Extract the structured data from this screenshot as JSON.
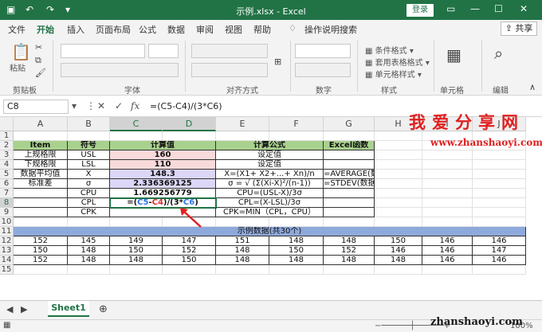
{
  "window": {
    "title": "示例.xlsx - Excel",
    "login": "登录"
  },
  "tabs": [
    "文件",
    "开始",
    "插入",
    "页面布局",
    "公式",
    "数据",
    "审阅",
    "视图",
    "帮助"
  ],
  "tell_me": "操作说明搜索",
  "share": "共享",
  "ribbon": {
    "paste": "粘贴",
    "clipboard": "剪贴板",
    "font": "字体",
    "alignment": "对齐方式",
    "number": "数字",
    "styles": "样式",
    "cells": "单元格",
    "editing": "编辑",
    "cond_format": "条件格式",
    "table_format": "套用表格格式",
    "cell_styles": "单元格样式"
  },
  "formula_bar": {
    "name_box": "C8",
    "fx": "fx",
    "formula": "=(C5-C4)/(3*C6)"
  },
  "columns": [
    "A",
    "B",
    "C",
    "D",
    "E",
    "F",
    "G",
    "H",
    "I",
    "J"
  ],
  "rows": [
    "1",
    "2",
    "3",
    "4",
    "5",
    "6",
    "7",
    "8",
    "9",
    "10",
    "11",
    "12",
    "13",
    "14",
    "15"
  ],
  "table": {
    "headers": [
      "Item",
      "符号",
      "计算值",
      "计算公式",
      "Excel函数"
    ],
    "rows": [
      {
        "item": "上规格限",
        "sym": "USL",
        "val": "160",
        "formula": "设定值",
        "excel": ""
      },
      {
        "item": "下规格限",
        "sym": "LSL",
        "val": "110",
        "formula": "设定值",
        "excel": ""
      },
      {
        "item": "数据平均值",
        "sym": "X",
        "val": "148.3",
        "formula": "X=(X1+ X2+...+ Xn)/n",
        "excel": "=AVERAGE(数据区域)"
      },
      {
        "item": "标准差",
        "sym": "σ",
        "val": "2.336369125",
        "formula": "σ = √ (Σ(Xi-X)²/(n-1))",
        "excel": "=STDEV(数据区域)"
      },
      {
        "item": "",
        "sym": "CPU",
        "val": "1.669256779",
        "formula": "CPU=(USL-X)/3σ",
        "excel": ""
      },
      {
        "item": "",
        "sym": "CPL",
        "val": "",
        "formula": "CPL=(X-LSL)/3σ",
        "excel": ""
      },
      {
        "item": "",
        "sym": "CPK",
        "val": "",
        "formula": "CPK=MIN（CPL，CPU）",
        "excel": ""
      }
    ],
    "cpl_formula_parts": [
      "=(",
      "C5",
      "-",
      "C4",
      ")/(3*",
      "C6",
      ")"
    ]
  },
  "sample": {
    "title": "示例数据(共30个)",
    "rows": [
      [
        "152",
        "145",
        "149",
        "147",
        "151",
        "148",
        "148",
        "150",
        "146",
        "146"
      ],
      [
        "150",
        "148",
        "150",
        "152",
        "148",
        "150",
        "152",
        "146",
        "146",
        "147"
      ],
      [
        "152",
        "148",
        "148",
        "150",
        "148",
        "148",
        "148",
        "148",
        "146",
        "146"
      ]
    ]
  },
  "brand": {
    "name": "我爱分享网",
    "url": "www.zhanshaoyi.com",
    "footer_url": "zhanshaoyi.com"
  },
  "sheet_tab": "Sheet1",
  "zoom": "100%"
}
